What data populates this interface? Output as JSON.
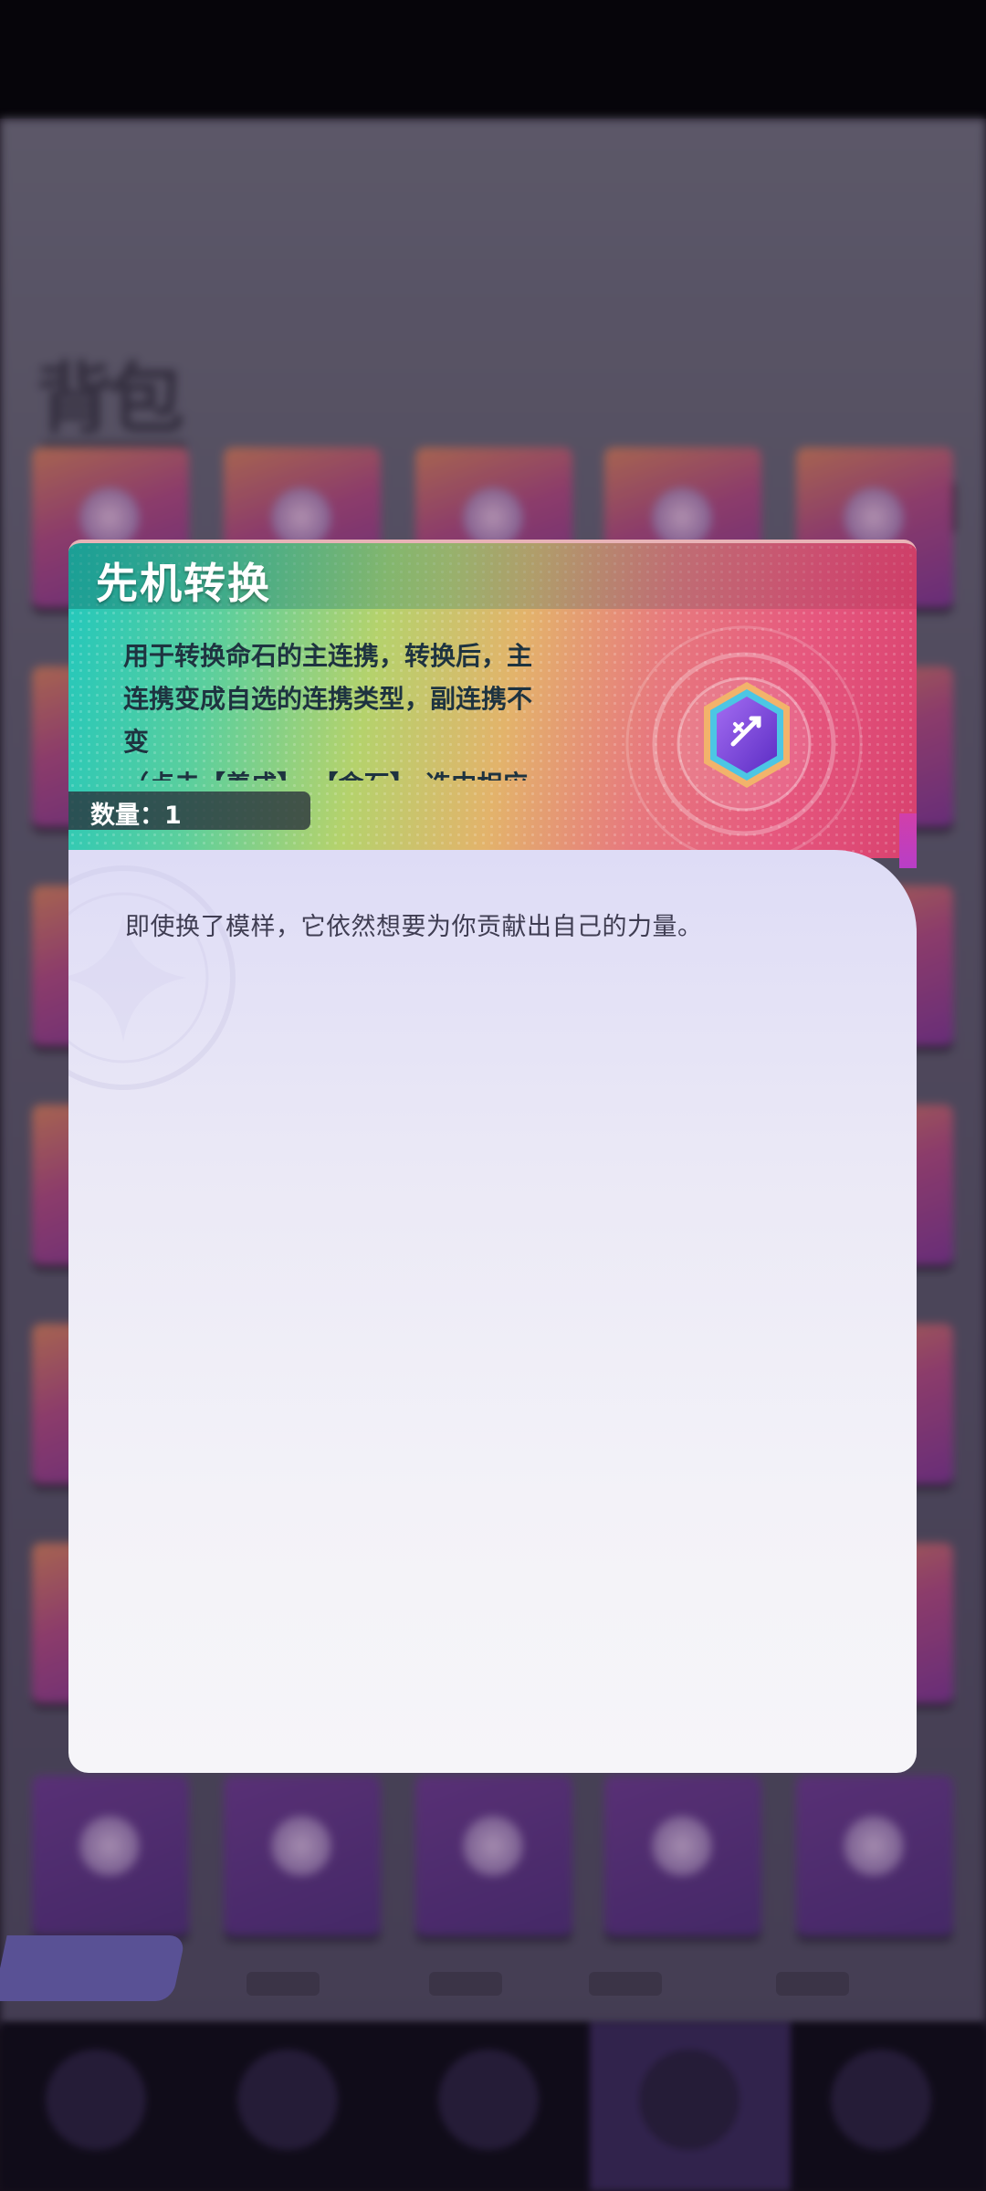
{
  "background": {
    "page_title": "背包",
    "tabs": [
      "",
      "",
      "",
      "",
      ""
    ]
  },
  "modal": {
    "title": "先机转换",
    "description_lines": [
      "用于转换命石的主连携，转换后，主",
      "连携变成自选的连携类型，副连携不",
      "变",
      "（点击【养成】-【命石】-选中相应"
    ],
    "quantity_label": "数量：",
    "quantity_value": "1",
    "flavor_text": "即使换了模样，它依然想要为你贡献出自己的力量。",
    "icon": "hexagon-conversion-icon"
  },
  "colors": {
    "header_start": "#21c7bd",
    "header_end": "#d8406e",
    "body_top": "#dedcf6",
    "body_bottom": "#f6f5f9",
    "title_text": "#ffffff",
    "description_text": "#1e3340",
    "flavor_text": "#3f3d52"
  }
}
